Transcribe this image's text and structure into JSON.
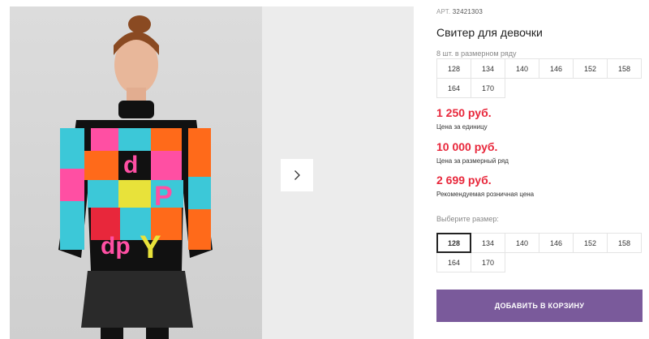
{
  "gallery": {
    "next_icon": "chevron-right-icon"
  },
  "product": {
    "article_label": "АРТ.",
    "article_value": "32421303",
    "title": "Свитер для девочки",
    "size_row_label": "8 шт. в размерном ряду",
    "size_row": [
      "128",
      "134",
      "140",
      "146",
      "152",
      "158",
      "164",
      "170"
    ],
    "prices": [
      {
        "value": "1 250 руб.",
        "caption": "Цена за единицу"
      },
      {
        "value": "10 000 руб.",
        "caption": "Цена за размерный ряд"
      },
      {
        "value": "2 699 руб.",
        "caption": "Рекомендуемая розничная цена"
      }
    ],
    "price_color": "#e8273b",
    "choose_size_label": "Выберите размер:",
    "choose_sizes": [
      "128",
      "134",
      "140",
      "146",
      "152",
      "158",
      "164",
      "170"
    ],
    "selected_size": "128",
    "add_to_cart_label": "ДОБАВИТЬ В КОРЗИНУ",
    "button_color": "#7a5a9b"
  }
}
